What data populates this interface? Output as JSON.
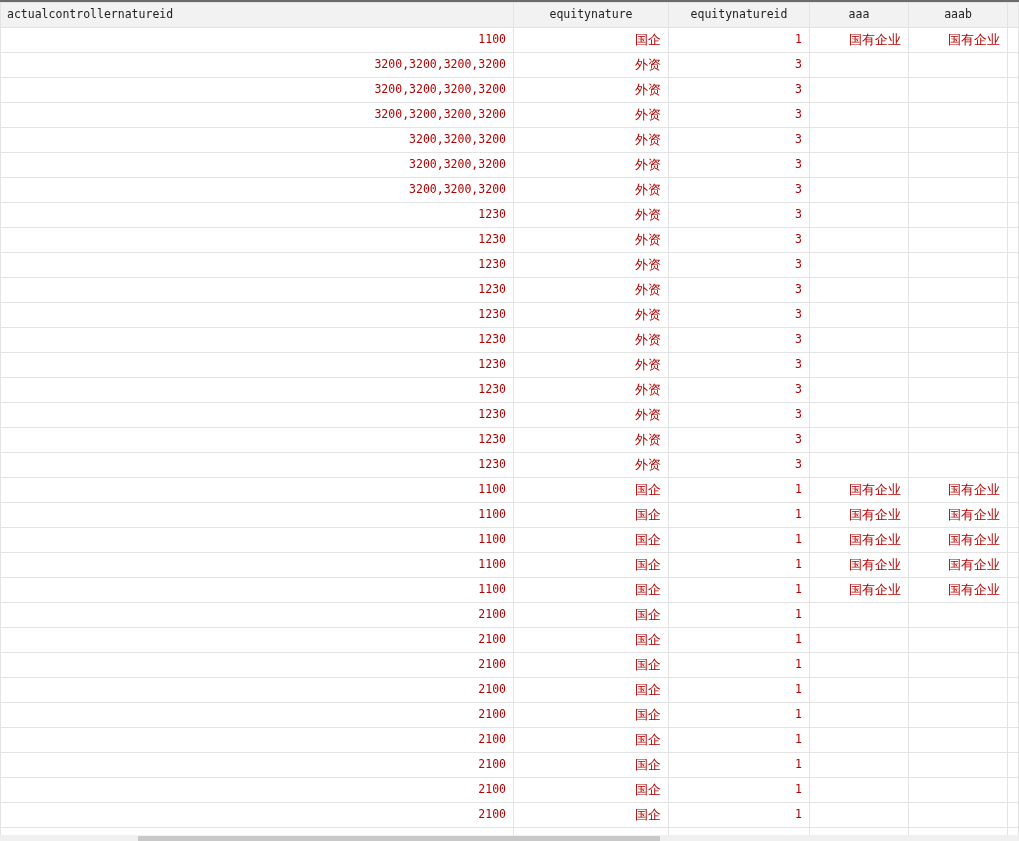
{
  "table": {
    "columns": [
      "actualcontrollernatureid",
      "equitynature",
      "equitynatureid",
      "aaa",
      "aaab"
    ],
    "rows": [
      [
        "1100",
        "国企",
        "1",
        "国有企业",
        "国有企业"
      ],
      [
        "3200,3200,3200,3200",
        "外资",
        "3",
        null,
        null
      ],
      [
        "3200,3200,3200,3200",
        "外资",
        "3",
        null,
        null
      ],
      [
        "3200,3200,3200,3200",
        "外资",
        "3",
        null,
        null
      ],
      [
        "3200,3200,3200",
        "外资",
        "3",
        null,
        null
      ],
      [
        "3200,3200,3200",
        "外资",
        "3",
        null,
        null
      ],
      [
        "3200,3200,3200",
        "外资",
        "3",
        null,
        null
      ],
      [
        "1230",
        "外资",
        "3",
        null,
        null
      ],
      [
        "1230",
        "外资",
        "3",
        null,
        null
      ],
      [
        "1230",
        "外资",
        "3",
        null,
        null
      ],
      [
        "1230",
        "外资",
        "3",
        null,
        null
      ],
      [
        "1230",
        "外资",
        "3",
        null,
        null
      ],
      [
        "1230",
        "外资",
        "3",
        null,
        null
      ],
      [
        "1230",
        "外资",
        "3",
        null,
        null
      ],
      [
        "1230",
        "外资",
        "3",
        null,
        null
      ],
      [
        "1230",
        "外资",
        "3",
        null,
        null
      ],
      [
        "1230",
        "外资",
        "3",
        null,
        null
      ],
      [
        "1230",
        "外资",
        "3",
        null,
        null
      ],
      [
        "1100",
        "国企",
        "1",
        "国有企业",
        "国有企业"
      ],
      [
        "1100",
        "国企",
        "1",
        "国有企业",
        "国有企业"
      ],
      [
        "1100",
        "国企",
        "1",
        "国有企业",
        "国有企业"
      ],
      [
        "1100",
        "国企",
        "1",
        "国有企业",
        "国有企业"
      ],
      [
        "1100",
        "国企",
        "1",
        "国有企业",
        "国有企业"
      ],
      [
        "2100",
        "国企",
        "1",
        null,
        null
      ],
      [
        "2100",
        "国企",
        "1",
        null,
        null
      ],
      [
        "2100",
        "国企",
        "1",
        null,
        null
      ],
      [
        "2100",
        "国企",
        "1",
        null,
        null
      ],
      [
        "2100",
        "国企",
        "1",
        null,
        null
      ],
      [
        "2100",
        "国企",
        "1",
        null,
        null
      ],
      [
        "2100",
        "国企",
        "1",
        null,
        null
      ],
      [
        "2100",
        "国企",
        "1",
        null,
        null
      ],
      [
        "2100",
        "国企",
        "1",
        null,
        null
      ]
    ]
  }
}
